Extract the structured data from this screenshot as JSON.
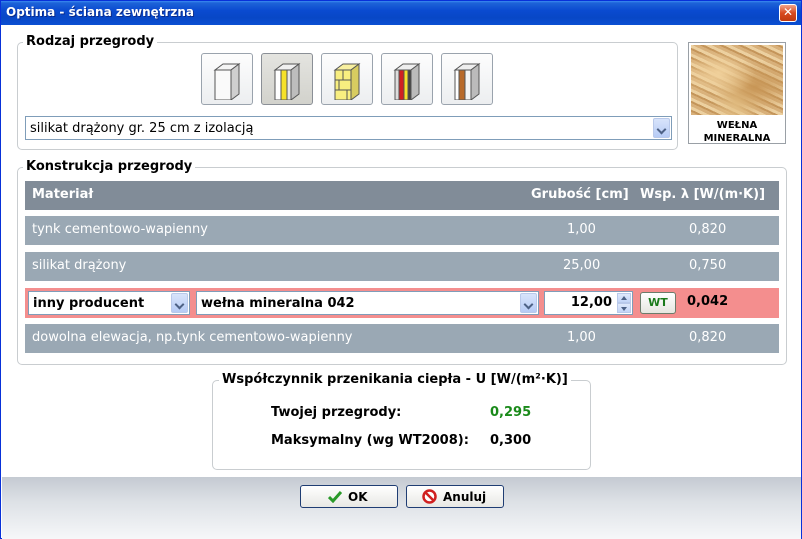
{
  "window": {
    "title": "Optima - ściana zewnętrzna",
    "close_symbol": "✕"
  },
  "rodzaj": {
    "label": "Rodzaj przegrody",
    "icons": [
      "wall-plain-icon",
      "wall-insulated-icon",
      "wall-brick-icon",
      "wall-layered-icon",
      "wall-wood-icon"
    ],
    "selected_index": 1,
    "select_value": "silikat drążony gr. 25 cm z izolacją",
    "thumb_caption_1": "WEŁNA",
    "thumb_caption_2": "MINERALNA"
  },
  "konstrukcja": {
    "label": "Konstrukcja przegrody",
    "headers": {
      "material": "Materiał",
      "grubosc": "Grubość [cm]",
      "lambda": "Wsp. λ [W/(m·K)]"
    },
    "rows": [
      {
        "material": "tynk cementowo-wapienny",
        "grubosc": "1,00",
        "lambda": "0,820"
      },
      {
        "material": "silikat drążony",
        "grubosc": "25,00",
        "lambda": "0,750"
      },
      {
        "producer": "inny producent",
        "material": "wełna mineralna 042",
        "grubosc": "12,00",
        "wt_label": "WT",
        "lambda": "0,042"
      },
      {
        "material": "dowolna elewacja, np.tynk cementowo-wapienny",
        "grubosc": "1,00",
        "lambda": "0,820"
      }
    ]
  },
  "wspolczynnik": {
    "label": "Współczynnik przenikania ciepła - U [W/(m²·K)]",
    "twoja_label": "Twojej przegrody:",
    "twoja_value": "0,295",
    "max_label": "Maksymalny (wg WT2008):",
    "max_value": "0,300",
    "colors": {
      "twoja": "#1a8a1a"
    }
  },
  "buttons": {
    "ok": "OK",
    "cancel": "Anuluj"
  }
}
